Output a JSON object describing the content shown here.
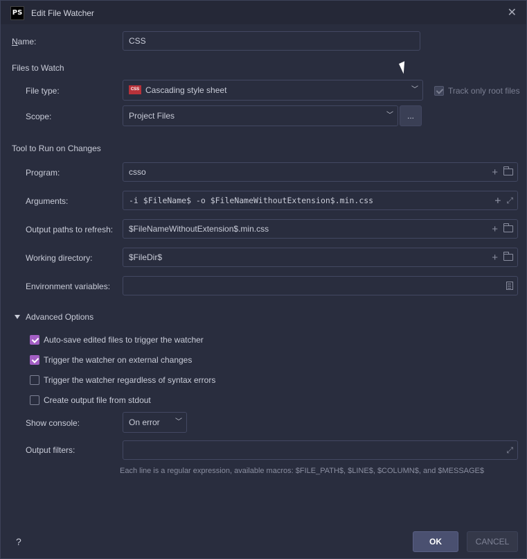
{
  "window": {
    "logo": "PS",
    "title": "Edit File Watcher"
  },
  "name": {
    "label": "Name:",
    "value": "CSS"
  },
  "files_to_watch": {
    "section": "Files to Watch",
    "file_type_label": "File type:",
    "file_type_value": "Cascading style sheet",
    "file_type_icon_text": "CSS",
    "track_only_root": "Track only root files",
    "scope_label": "Scope:",
    "scope_value": "Project Files",
    "scope_dots": "..."
  },
  "tool": {
    "section": "Tool to Run on Changes",
    "program_label": "Program:",
    "program_value": "csso",
    "arguments_label": "Arguments:",
    "arguments_value": "-i $FileName$ -o $FileNameWithoutExtension$.min.css",
    "output_paths_label": "Output paths to refresh:",
    "output_paths_value": "$FileNameWithoutExtension$.min.css",
    "working_dir_label": "Working directory:",
    "working_dir_value": "$FileDir$",
    "env_label": "Environment variables:",
    "env_value": ""
  },
  "advanced": {
    "section": "Advanced Options",
    "auto_save": "Auto-save edited files to trigger the watcher",
    "external_changes": "Trigger the watcher on external changes",
    "syntax_errors": "Trigger the watcher regardless of syntax errors",
    "stdout": "Create output file from stdout",
    "show_console_label": "Show console:",
    "show_console_value": "On error",
    "output_filters_label": "Output filters:",
    "output_filters_value": "",
    "hint": "Each line is a regular expression, available macros: $FILE_PATH$, $LINE$, $COLUMN$, and $MESSAGE$"
  },
  "footer": {
    "help": "?",
    "ok": "OK",
    "cancel": "CANCEL"
  },
  "colors": {
    "background": "#292d3e",
    "accent_checkbox": "#a35fc4",
    "ok_button": "#4a5070"
  }
}
